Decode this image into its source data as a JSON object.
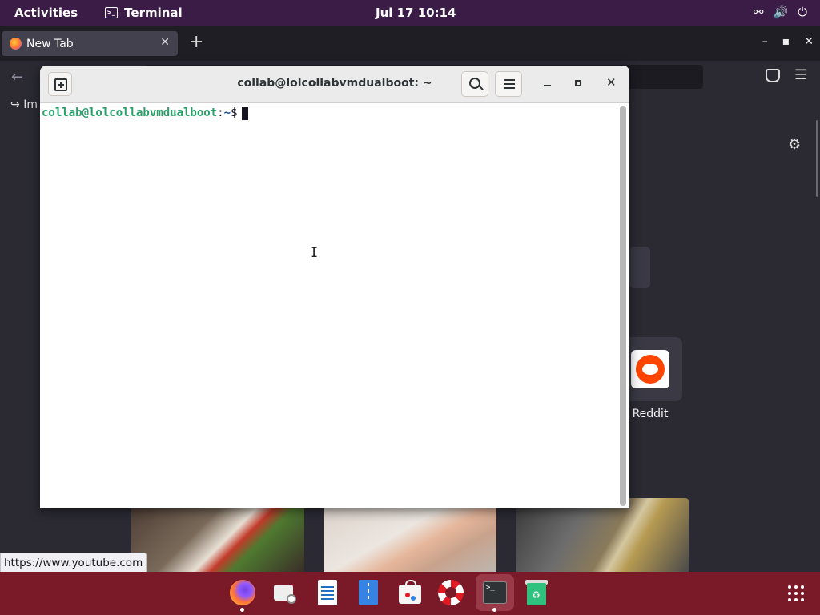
{
  "topbar": {
    "activities": "Activities",
    "app_name": "Terminal",
    "clock": "Jul 17  10:14"
  },
  "firefox": {
    "tab_title": "New Tab",
    "bookmark_import_label": "Im",
    "shortcut_reddit_label": "Reddit",
    "status_url": "https://www.youtube.com"
  },
  "terminal": {
    "title": "collab@lolcollabvmdualboot: ~",
    "prompt_user": "collab@lolcollabvmdualboot",
    "prompt_sep": ":",
    "prompt_path": "~",
    "prompt_symbol": "$"
  },
  "dock": {
    "items": [
      "Firefox",
      "Evolution",
      "LibreOffice Writer",
      "Document Viewer",
      "Software",
      "Help",
      "Terminal",
      "Trash"
    ]
  },
  "colors": {
    "topbar_bg": "#3b1c47",
    "dock_bg": "#7a1a28",
    "prompt_user": "#26a269",
    "prompt_path": "#12488b"
  },
  "icons": {
    "network": "network-icon",
    "volume": "volume-icon",
    "power": "power-icon",
    "settings": "gear-icon",
    "pocket": "pocket-icon",
    "menu": "hamburger-menu-icon"
  }
}
